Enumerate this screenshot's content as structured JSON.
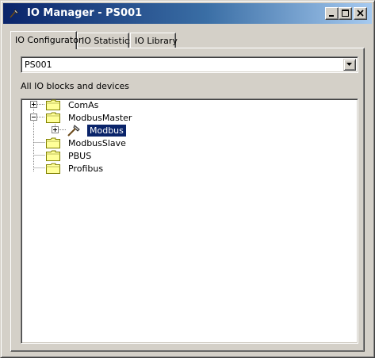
{
  "window": {
    "title": "IO Manager - PS001"
  },
  "tabs": [
    {
      "label": "IO Configurator",
      "active": true
    },
    {
      "label": "IO Statistics",
      "active": false
    },
    {
      "label": "IO Library",
      "active": false
    }
  ],
  "configurator": {
    "station_select": {
      "value": "PS001"
    },
    "tree_heading": "All IO blocks and devices",
    "tree": [
      {
        "label": "ComAs",
        "level": 0,
        "expander": "plus",
        "icon": "folder-icon"
      },
      {
        "label": "ModbusMaster",
        "level": 0,
        "expander": "minus",
        "icon": "folder-icon"
      },
      {
        "label": "Modbus",
        "level": 1,
        "expander": "plus",
        "icon": "hammer-icon",
        "selected": true
      },
      {
        "label": "ModbusSlave",
        "level": 0,
        "expander": "none",
        "icon": "folder-icon"
      },
      {
        "label": "PBUS",
        "level": 0,
        "expander": "none",
        "icon": "folder-icon"
      },
      {
        "label": "Profibus",
        "level": 0,
        "expander": "none",
        "icon": "folder-icon"
      }
    ]
  },
  "colors": {
    "title_gradient_start": "#0a246a",
    "title_gradient_end": "#a6caf0",
    "face": "#d4d0c8",
    "selection": "#0a246a",
    "folder": "#ffff99"
  }
}
